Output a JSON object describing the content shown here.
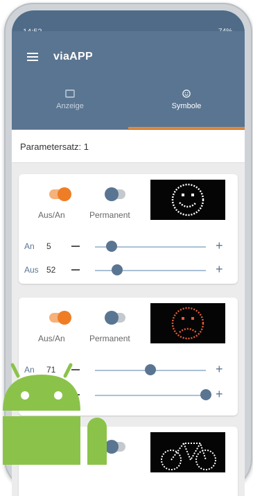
{
  "status_bar": {
    "time": "14:52",
    "battery": "74%"
  },
  "app_bar": {
    "title": "viaAPP"
  },
  "tabs": [
    {
      "label": "Anzeige",
      "icon": "rectangle-icon",
      "selected": false
    },
    {
      "label": "Symbole",
      "icon": "smiley-icon",
      "selected": true
    }
  ],
  "parameter": {
    "label": "Parametersatz: 1"
  },
  "cards": [
    {
      "toggle1_label": "Aus/An",
      "toggle1_on": true,
      "toggle2_label": "Permanent",
      "toggle2_on": false,
      "symbol": "smiley-happy-icon",
      "symbol_color": "#ffffff",
      "rows": [
        {
          "label": "An",
          "value": "5",
          "level": 0.15
        },
        {
          "label": "Aus",
          "value": "52",
          "level": 0.2
        }
      ]
    },
    {
      "toggle1_label": "Aus/An",
      "toggle1_on": true,
      "toggle2_label": "Permanent",
      "toggle2_on": false,
      "symbol": "smiley-sad-icon",
      "symbol_color": "#e05a3a",
      "rows": [
        {
          "label": "An",
          "value": "71",
          "level": 0.5
        },
        {
          "label": "",
          "value": "",
          "level": 1.0
        }
      ]
    },
    {
      "symbol": "bicycle-icon",
      "symbol_color": "#ffffff"
    }
  ],
  "colors": {
    "primary": "#5a7591",
    "accent": "#ee7d26",
    "android_green": "#8bc34a"
  }
}
